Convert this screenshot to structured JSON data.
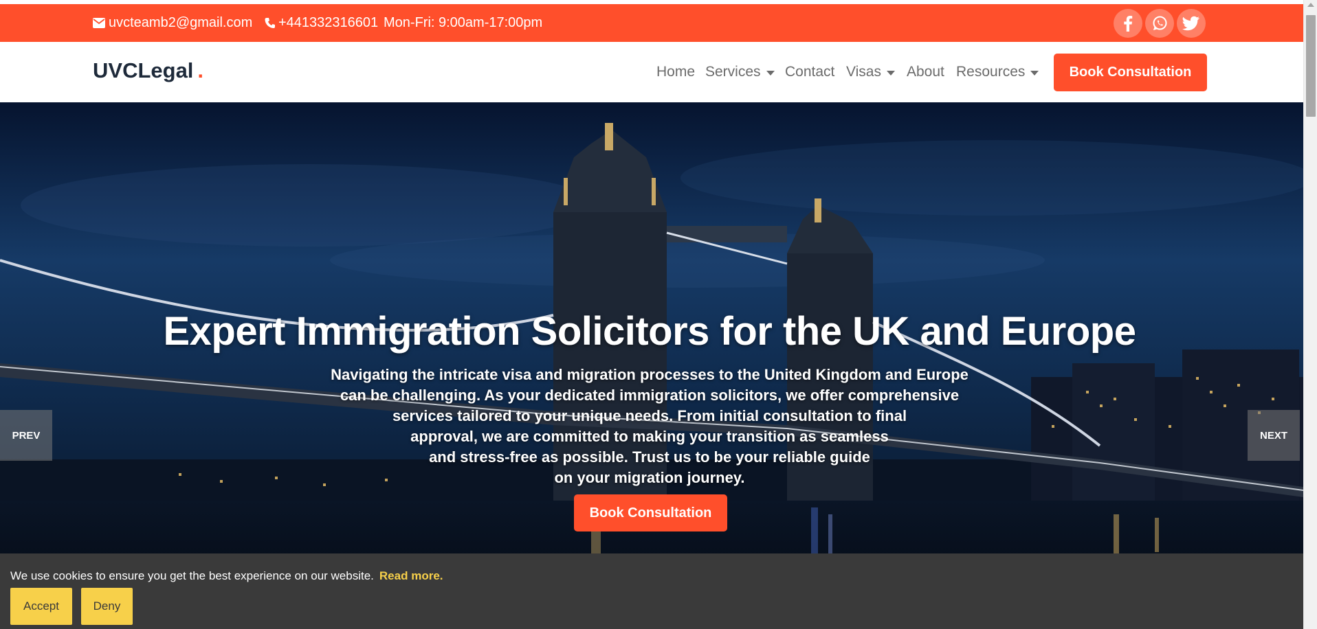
{
  "topbar": {
    "email": "uvcteamb2@gmail.com",
    "phone": "+441332316601",
    "hours": "Mon-Fri: 9:00am-17:00pm",
    "social": [
      "facebook-icon",
      "whatsapp-icon",
      "twitter-icon"
    ],
    "bg_color": "#ff4f2b"
  },
  "navbar": {
    "brand": "UVCLegal",
    "brand_dot": ".",
    "items": [
      {
        "label": "Home",
        "dropdown": false
      },
      {
        "label": "Services",
        "dropdown": true
      },
      {
        "label": "Contact",
        "dropdown": false
      },
      {
        "label": "Visas",
        "dropdown": true
      },
      {
        "label": "About",
        "dropdown": false
      },
      {
        "label": "Resources",
        "dropdown": true
      }
    ],
    "cta": "Book Consultation"
  },
  "hero": {
    "title": "Expert Immigration Solicitors for the UK and Europe",
    "lines": [
      "Navigating the intricate visa and migration processes to the United Kingdom and Europe",
      "can be challenging. As your dedicated immigration solicitors, we offer comprehensive",
      "services tailored to your unique needs. From initial consultation to final",
      "approval, we are committed to making your transition as seamless",
      "and stress-free as possible. Trust us to be your reliable guide",
      "on your migration journey."
    ],
    "cta": "Book Consultation",
    "prev": "PREV",
    "next": "NEXT"
  },
  "cookie": {
    "message": "We use cookies to ensure you get the best experience on our website.",
    "read_more": "Read more",
    "read_more_suffix": ".",
    "accept": "Accept",
    "deny": "Deny",
    "accent_color": "#f7d04a"
  }
}
